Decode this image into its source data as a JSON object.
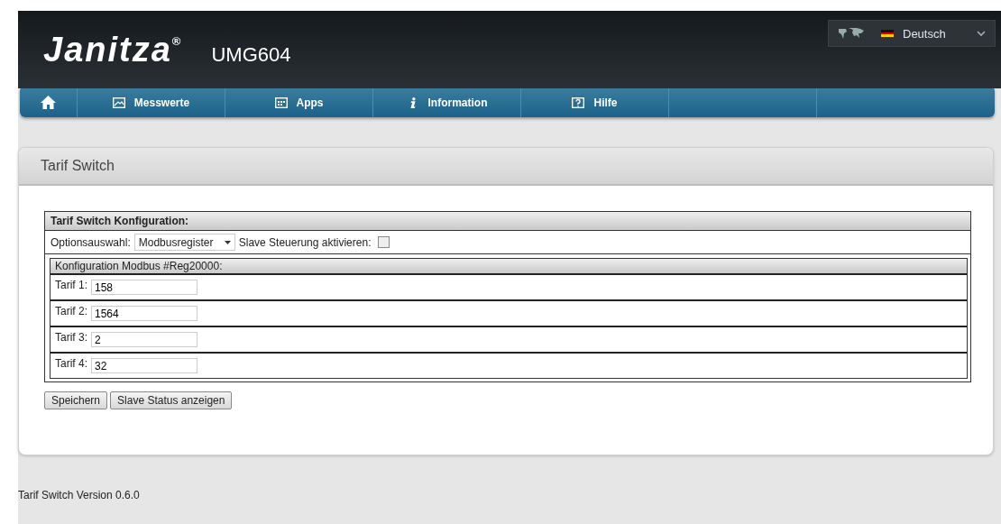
{
  "header": {
    "logo": "Janitza",
    "logo_mark": "®",
    "device": "UMG604",
    "language": "Deutsch"
  },
  "nav": [
    {
      "kind": "home"
    },
    {
      "kind": "chart",
      "label": "Messwerte"
    },
    {
      "kind": "apps",
      "label": "Apps"
    },
    {
      "kind": "info",
      "label": "Information"
    },
    {
      "kind": "help",
      "label": "Hilfe"
    }
  ],
  "panel": {
    "title": "Tarif Switch",
    "config": {
      "title": "Tarif Switch Konfiguration:",
      "option_label": "Optionsauswahl:",
      "option_value": "Modbusregister",
      "slave_label": "Slave Steuerung aktivieren:",
      "slave_checked": false,
      "modbus": {
        "title": "Konfiguration Modbus #Reg20000:",
        "tariffs": [
          {
            "label": "Tarif 1:",
            "value": "158"
          },
          {
            "label": "Tarif 2:",
            "value": "1564"
          },
          {
            "label": "Tarif 3:",
            "value": "2"
          },
          {
            "label": "Tarif 4:",
            "value": "32"
          }
        ]
      }
    },
    "buttons": [
      "Speichern",
      "Slave Status anzeigen"
    ]
  },
  "footer": "Tarif Switch Version 0.6.0"
}
